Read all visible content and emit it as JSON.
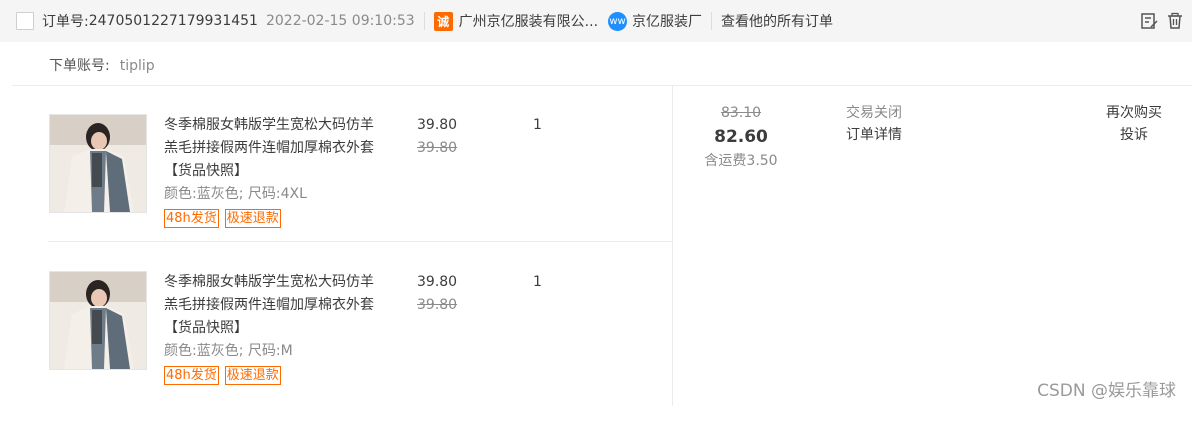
{
  "header": {
    "order_label": "订单号:",
    "order_no": "2470501227179931451",
    "date": "2022-02-15 09:10:53",
    "shop_icon_text": "诚",
    "shop_name": "广州京亿服装有限公...",
    "ww_icon_text": "ww",
    "seller": "京亿服装厂",
    "view_all": "查看他的所有订单",
    "icons": [
      "flag-edit-icon",
      "trash-icon"
    ]
  },
  "account": {
    "label": "下单账号:",
    "value": "tiplip"
  },
  "items": [
    {
      "title": "冬季棉服女韩版学生宽松大码仿羊羔毛拼接假两件连帽加厚棉衣外套",
      "snapshot": "【货品快照】",
      "attrs": "颜色:蓝灰色; 尺码:4XL",
      "tags": [
        "48h发货",
        "极速退款"
      ],
      "price": "39.80",
      "orig_price": "39.80",
      "qty": "1"
    },
    {
      "title": "冬季棉服女韩版学生宽松大码仿羊羔毛拼接假两件连帽加厚棉衣外套",
      "snapshot": "【货品快照】",
      "attrs": "颜色:蓝灰色; 尺码:M",
      "tags": [
        "48h发货",
        "极速退款"
      ],
      "price": "39.80",
      "orig_price": "39.80",
      "qty": "1"
    }
  ],
  "total": {
    "orig": "83.10",
    "now": "82.60",
    "shipping": "含运费3.50"
  },
  "status": {
    "state": "交易关闭",
    "detail": "订单详情"
  },
  "ops": {
    "rebuy": "再次购买",
    "complain": "投诉"
  },
  "watermark": "CSDN @娱乐靠球",
  "colors": {
    "accent": "#ff6a00",
    "header_bg": "#f5f5f5",
    "ww_blue": "#1e8fff"
  }
}
